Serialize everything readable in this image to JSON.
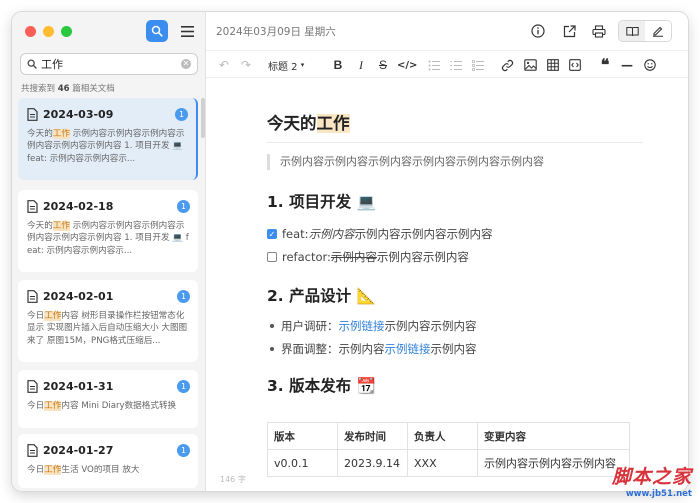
{
  "sidebar": {
    "search_value": "工作",
    "result_prefix": "共搜索到",
    "result_count": "46",
    "result_suffix": "篇相关文档",
    "items": [
      {
        "date": "2024-03-09",
        "badge": "1",
        "pre": "今天的",
        "hl": "工作",
        "post": " 示例内容示例内容示例内容示例内容示例内容示例内容 1. 项目开发 💻 feat: 示例内容示例内容示..."
      },
      {
        "date": "2024-02-18",
        "badge": "1",
        "pre": "今天的",
        "hl": "工作",
        "post": " 示例内容示例内容示例内容示例内容示例内容示例内容 1. 项目开发 💻 feat: 示例内容示例内容示..."
      },
      {
        "date": "2024-02-01",
        "badge": "1",
        "pre": "今日",
        "hl": "工作",
        "post": "内容 树形目录操作栏按钮常态化显示 实现图片插入后自动压缩大小 大图图来了 原图15M，PNG格式压缩后..."
      },
      {
        "date": "2024-01-31",
        "badge": "1",
        "pre": "今日",
        "hl": "工作",
        "post": "内容 Mini Diary数据格式转换"
      },
      {
        "date": "2024-01-27",
        "badge": "1",
        "pre": "今日",
        "hl": "工作",
        "post": "生活 VO的项目 放大"
      }
    ]
  },
  "topbar": {
    "date": "2024年03月09日 星期六"
  },
  "toolbar": {
    "heading_label": "标题 2"
  },
  "doc": {
    "title_pre": "今天的",
    "title_hl": "工作",
    "quote": "示例内容示例内容示例内容示例内容示例内容示例内容",
    "h1": "1. 项目开发 💻",
    "task1_prefix": "feat: ",
    "task1_italic": "示例内容",
    "task1_rest": "示例内容示例内容示例内容",
    "task2_prefix": "refactor: ",
    "task2_strike": "示例内容",
    "task2_rest": "示例内容示例内容",
    "h2": "2. 产品设计 📐",
    "b1_prefix": "用户调研：",
    "b1_link": "示例链接",
    "b1_rest": "示例内容示例内容",
    "b2_prefix": "界面调整：示例内容",
    "b2_link": "示例链接",
    "b2_rest": "示例内容",
    "h3": "3. 版本发布 📆",
    "table": {
      "headers": [
        "版本",
        "发布时间",
        "负责人",
        "变更内容"
      ],
      "row": [
        "v0.0.1",
        "2023.9.14",
        "XXX",
        "示例内容示例内容示例内容"
      ]
    },
    "word_count": "146 字"
  },
  "watermark": {
    "big": "脚本之家",
    "small": "www.jb51.net"
  },
  "colors": {
    "accent": "#3b8ef0",
    "highlight": "#f9e3bf",
    "link": "#2f7fd8"
  }
}
